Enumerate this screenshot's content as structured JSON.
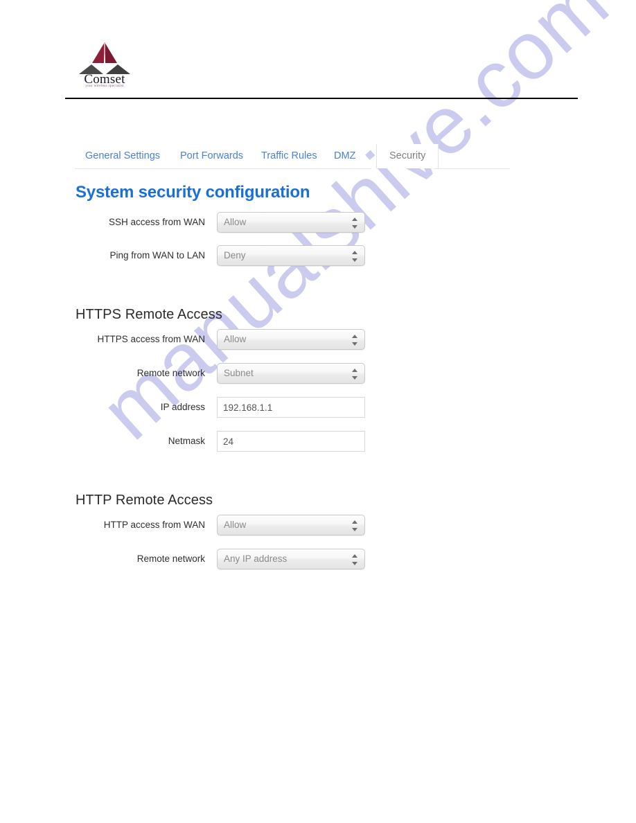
{
  "header": {
    "logo_name": "Comset",
    "logo_tagline": "your wireless specialist",
    "logo_icon": "comset-pyramid-logo"
  },
  "watermark": {
    "text": "manualshive.com"
  },
  "tabs": [
    {
      "label": "General Settings",
      "active": false
    },
    {
      "label": "Port Forwards",
      "active": false
    },
    {
      "label": "Traffic Rules",
      "active": false
    },
    {
      "label": "DMZ",
      "active": false
    },
    {
      "label": "Security",
      "active": true
    }
  ],
  "page_title": "System security configuration",
  "sections": [
    {
      "heading": "",
      "fields": [
        {
          "label": "SSH access from WAN",
          "type": "select",
          "value": "Allow"
        },
        {
          "label": "Ping from WAN to LAN",
          "type": "select",
          "value": "Deny"
        }
      ]
    },
    {
      "heading": "HTTPS Remote Access",
      "fields": [
        {
          "label": "HTTPS access from WAN",
          "type": "select",
          "value": "Allow"
        },
        {
          "label": "Remote network",
          "type": "select",
          "value": "Subnet"
        },
        {
          "label": "IP address",
          "type": "text",
          "value": "192.168.1.1"
        },
        {
          "label": "Netmask",
          "type": "text",
          "value": "24"
        }
      ]
    },
    {
      "heading": "HTTP Remote Access",
      "fields": [
        {
          "label": "HTTP access from WAN",
          "type": "select",
          "value": "Allow"
        },
        {
          "label": "Remote network",
          "type": "select",
          "value": "Any IP address"
        }
      ]
    }
  ],
  "colors": {
    "link_blue": "#4a7fd4",
    "title_blue": "#1a6fd4",
    "watermark": "#c9c9ef",
    "logo_red": "#8e1f38",
    "logo_gray": "#4a4a4a"
  }
}
